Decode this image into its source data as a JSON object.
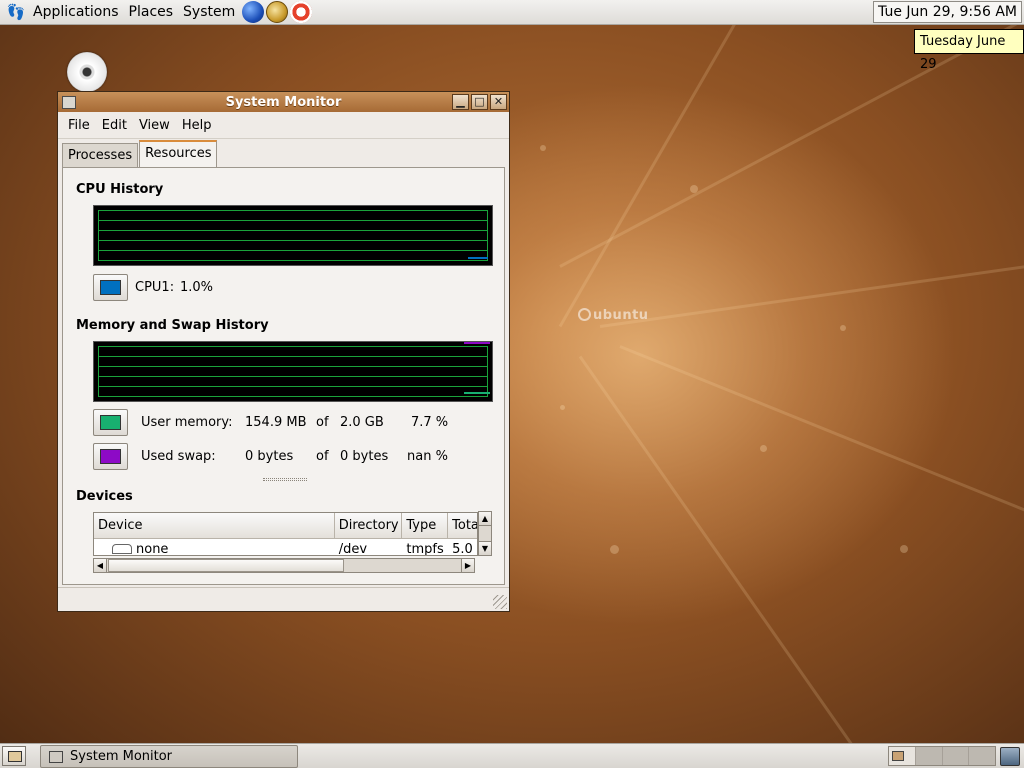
{
  "top_panel": {
    "menus": [
      "Applications",
      "Places",
      "System"
    ],
    "launchers": [
      "web-browser-icon",
      "mail-icon",
      "help-icon"
    ],
    "clock": "Tue Jun 29,  9:56 AM",
    "tooltip": "Tuesday June 29"
  },
  "desktop": {
    "wallpaper_text": "ubuntu",
    "icons": [
      "cd-drive-icon"
    ]
  },
  "window": {
    "title": "System Monitor",
    "menu": [
      "File",
      "Edit",
      "View",
      "Help"
    ],
    "tabs": [
      {
        "label": "Processes",
        "active": false
      },
      {
        "label": "Resources",
        "active": true
      }
    ],
    "cpu": {
      "title": "CPU History",
      "label": "CPU1:",
      "value": "1.0%",
      "color": "#0070c0"
    },
    "memory": {
      "title": "Memory and Swap History",
      "user_memory": {
        "label": "User memory:",
        "used": "154.9 MB",
        "of": "of",
        "total": "2.0 GB",
        "percent": "7.7 %",
        "color": "#18b070"
      },
      "used_swap": {
        "label": "Used swap:",
        "used": "0 bytes",
        "of": "of",
        "total": "0 bytes",
        "percent": "nan %",
        "color": "#8d0ac6"
      }
    },
    "devices": {
      "title": "Devices",
      "columns": [
        "Device",
        "Directory",
        "Type",
        "Total"
      ],
      "rows": [
        {
          "device": "none",
          "directory": "/dev",
          "type": "tmpfs",
          "total": "5.0"
        }
      ]
    }
  },
  "bottom_panel": {
    "task": "System Monitor",
    "workspaces": 4,
    "active_workspace": 1
  }
}
